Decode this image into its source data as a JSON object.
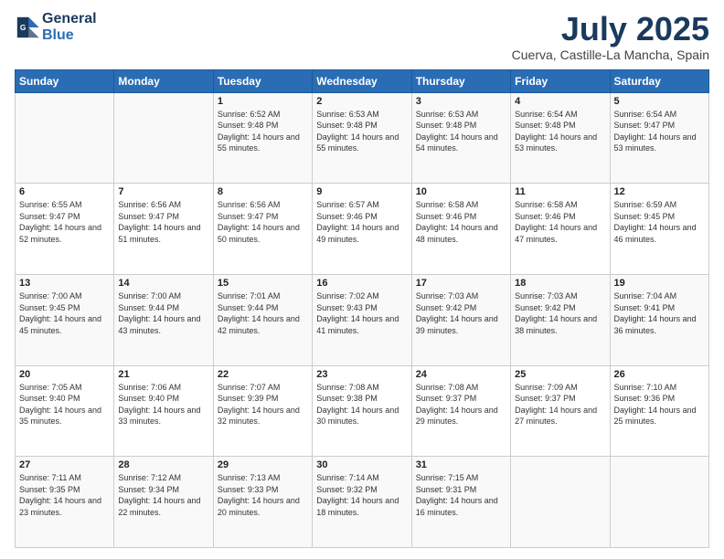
{
  "header": {
    "logo_line1": "General",
    "logo_line2": "Blue",
    "title": "July 2025",
    "subtitle": "Cuerva, Castille-La Mancha, Spain"
  },
  "weekdays": [
    "Sunday",
    "Monday",
    "Tuesday",
    "Wednesday",
    "Thursday",
    "Friday",
    "Saturday"
  ],
  "weeks": [
    [
      {
        "day": "",
        "sunrise": "",
        "sunset": "",
        "daylight": ""
      },
      {
        "day": "",
        "sunrise": "",
        "sunset": "",
        "daylight": ""
      },
      {
        "day": "1",
        "sunrise": "Sunrise: 6:52 AM",
        "sunset": "Sunset: 9:48 PM",
        "daylight": "Daylight: 14 hours and 55 minutes."
      },
      {
        "day": "2",
        "sunrise": "Sunrise: 6:53 AM",
        "sunset": "Sunset: 9:48 PM",
        "daylight": "Daylight: 14 hours and 55 minutes."
      },
      {
        "day": "3",
        "sunrise": "Sunrise: 6:53 AM",
        "sunset": "Sunset: 9:48 PM",
        "daylight": "Daylight: 14 hours and 54 minutes."
      },
      {
        "day": "4",
        "sunrise": "Sunrise: 6:54 AM",
        "sunset": "Sunset: 9:48 PM",
        "daylight": "Daylight: 14 hours and 53 minutes."
      },
      {
        "day": "5",
        "sunrise": "Sunrise: 6:54 AM",
        "sunset": "Sunset: 9:47 PM",
        "daylight": "Daylight: 14 hours and 53 minutes."
      }
    ],
    [
      {
        "day": "6",
        "sunrise": "Sunrise: 6:55 AM",
        "sunset": "Sunset: 9:47 PM",
        "daylight": "Daylight: 14 hours and 52 minutes."
      },
      {
        "day": "7",
        "sunrise": "Sunrise: 6:56 AM",
        "sunset": "Sunset: 9:47 PM",
        "daylight": "Daylight: 14 hours and 51 minutes."
      },
      {
        "day": "8",
        "sunrise": "Sunrise: 6:56 AM",
        "sunset": "Sunset: 9:47 PM",
        "daylight": "Daylight: 14 hours and 50 minutes."
      },
      {
        "day": "9",
        "sunrise": "Sunrise: 6:57 AM",
        "sunset": "Sunset: 9:46 PM",
        "daylight": "Daylight: 14 hours and 49 minutes."
      },
      {
        "day": "10",
        "sunrise": "Sunrise: 6:58 AM",
        "sunset": "Sunset: 9:46 PM",
        "daylight": "Daylight: 14 hours and 48 minutes."
      },
      {
        "day": "11",
        "sunrise": "Sunrise: 6:58 AM",
        "sunset": "Sunset: 9:46 PM",
        "daylight": "Daylight: 14 hours and 47 minutes."
      },
      {
        "day": "12",
        "sunrise": "Sunrise: 6:59 AM",
        "sunset": "Sunset: 9:45 PM",
        "daylight": "Daylight: 14 hours and 46 minutes."
      }
    ],
    [
      {
        "day": "13",
        "sunrise": "Sunrise: 7:00 AM",
        "sunset": "Sunset: 9:45 PM",
        "daylight": "Daylight: 14 hours and 45 minutes."
      },
      {
        "day": "14",
        "sunrise": "Sunrise: 7:00 AM",
        "sunset": "Sunset: 9:44 PM",
        "daylight": "Daylight: 14 hours and 43 minutes."
      },
      {
        "day": "15",
        "sunrise": "Sunrise: 7:01 AM",
        "sunset": "Sunset: 9:44 PM",
        "daylight": "Daylight: 14 hours and 42 minutes."
      },
      {
        "day": "16",
        "sunrise": "Sunrise: 7:02 AM",
        "sunset": "Sunset: 9:43 PM",
        "daylight": "Daylight: 14 hours and 41 minutes."
      },
      {
        "day": "17",
        "sunrise": "Sunrise: 7:03 AM",
        "sunset": "Sunset: 9:42 PM",
        "daylight": "Daylight: 14 hours and 39 minutes."
      },
      {
        "day": "18",
        "sunrise": "Sunrise: 7:03 AM",
        "sunset": "Sunset: 9:42 PM",
        "daylight": "Daylight: 14 hours and 38 minutes."
      },
      {
        "day": "19",
        "sunrise": "Sunrise: 7:04 AM",
        "sunset": "Sunset: 9:41 PM",
        "daylight": "Daylight: 14 hours and 36 minutes."
      }
    ],
    [
      {
        "day": "20",
        "sunrise": "Sunrise: 7:05 AM",
        "sunset": "Sunset: 9:40 PM",
        "daylight": "Daylight: 14 hours and 35 minutes."
      },
      {
        "day": "21",
        "sunrise": "Sunrise: 7:06 AM",
        "sunset": "Sunset: 9:40 PM",
        "daylight": "Daylight: 14 hours and 33 minutes."
      },
      {
        "day": "22",
        "sunrise": "Sunrise: 7:07 AM",
        "sunset": "Sunset: 9:39 PM",
        "daylight": "Daylight: 14 hours and 32 minutes."
      },
      {
        "day": "23",
        "sunrise": "Sunrise: 7:08 AM",
        "sunset": "Sunset: 9:38 PM",
        "daylight": "Daylight: 14 hours and 30 minutes."
      },
      {
        "day": "24",
        "sunrise": "Sunrise: 7:08 AM",
        "sunset": "Sunset: 9:37 PM",
        "daylight": "Daylight: 14 hours and 29 minutes."
      },
      {
        "day": "25",
        "sunrise": "Sunrise: 7:09 AM",
        "sunset": "Sunset: 9:37 PM",
        "daylight": "Daylight: 14 hours and 27 minutes."
      },
      {
        "day": "26",
        "sunrise": "Sunrise: 7:10 AM",
        "sunset": "Sunset: 9:36 PM",
        "daylight": "Daylight: 14 hours and 25 minutes."
      }
    ],
    [
      {
        "day": "27",
        "sunrise": "Sunrise: 7:11 AM",
        "sunset": "Sunset: 9:35 PM",
        "daylight": "Daylight: 14 hours and 23 minutes."
      },
      {
        "day": "28",
        "sunrise": "Sunrise: 7:12 AM",
        "sunset": "Sunset: 9:34 PM",
        "daylight": "Daylight: 14 hours and 22 minutes."
      },
      {
        "day": "29",
        "sunrise": "Sunrise: 7:13 AM",
        "sunset": "Sunset: 9:33 PM",
        "daylight": "Daylight: 14 hours and 20 minutes."
      },
      {
        "day": "30",
        "sunrise": "Sunrise: 7:14 AM",
        "sunset": "Sunset: 9:32 PM",
        "daylight": "Daylight: 14 hours and 18 minutes."
      },
      {
        "day": "31",
        "sunrise": "Sunrise: 7:15 AM",
        "sunset": "Sunset: 9:31 PM",
        "daylight": "Daylight: 14 hours and 16 minutes."
      },
      {
        "day": "",
        "sunrise": "",
        "sunset": "",
        "daylight": ""
      },
      {
        "day": "",
        "sunrise": "",
        "sunset": "",
        "daylight": ""
      }
    ]
  ]
}
